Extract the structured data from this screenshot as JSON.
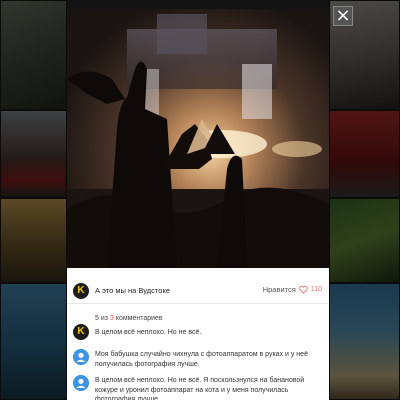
{
  "modal": {
    "close_symbol": "×",
    "post": {
      "avatar_letter": "K",
      "title": "А это мы на Вудстоке",
      "like_label": "Нравится",
      "like_count": "110"
    },
    "comments_summary": {
      "shown": "5",
      "of_word": "из",
      "total": "3",
      "noun": "комментариев"
    },
    "comments": [
      {
        "avatar_type": "k-logo",
        "text": "В целом всё неплохо. Но не всё."
      },
      {
        "avatar_type": "user-icon",
        "text": "Моя бабушка случайно чихнула с фотоаппаратом в руках и у неё получилась фотография лучше."
      },
      {
        "avatar_type": "user-icon",
        "text": "В целом всё неплохо. Но не всё. Я поскользнулся на банановой кожуре и уронил фотоаппарат на кота и у меня получилась фотография лучше."
      }
    ]
  },
  "colors": {
    "accent_red": "#e44b4b",
    "avatar_blue": "#3b94e4",
    "logo_yellow": "#f5c400"
  }
}
